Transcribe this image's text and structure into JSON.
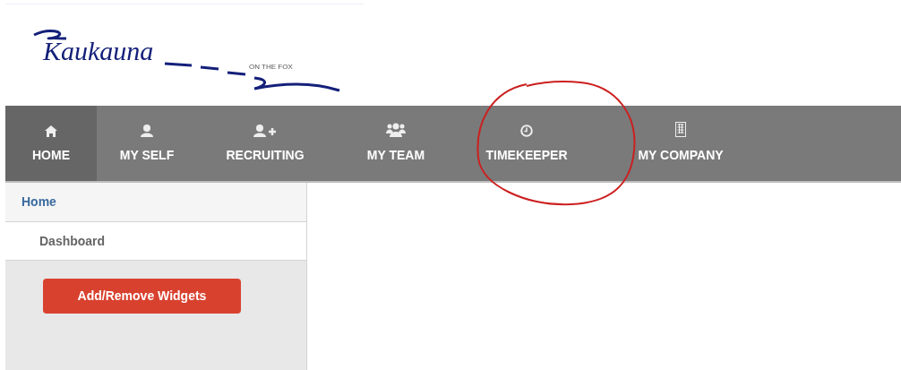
{
  "logo": {
    "text": "Kaukauna",
    "tagline": "ON THE FOX"
  },
  "nav": [
    {
      "label": "HOME",
      "selected": true
    },
    {
      "label": "MY SELF",
      "selected": false
    },
    {
      "label": "RECRUITING",
      "selected": false
    },
    {
      "label": "MY TEAM",
      "selected": false
    },
    {
      "label": "TIMEKEEPER",
      "selected": false
    },
    {
      "label": "MY COMPANY",
      "selected": false
    }
  ],
  "sidebar": {
    "heading": "Home",
    "items": [
      {
        "label": "Dashboard"
      }
    ],
    "button": "Add/Remove Widgets"
  }
}
